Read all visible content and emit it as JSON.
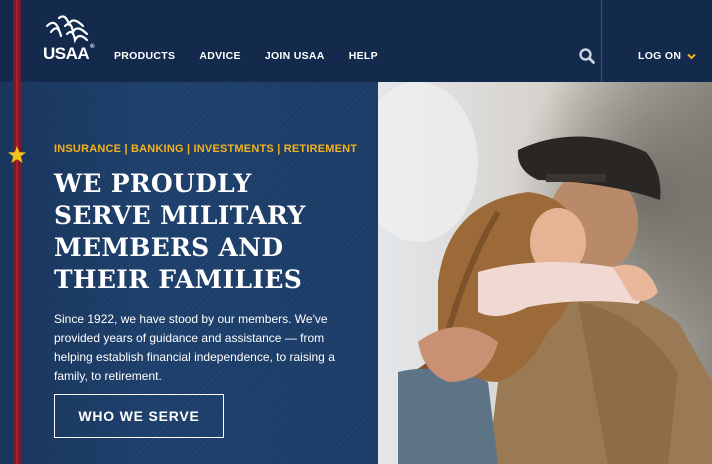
{
  "header": {
    "logo_text": "USAA",
    "logo_reg": "®",
    "nav": [
      "PRODUCTS",
      "ADVICE",
      "JOIN USAA",
      "HELP"
    ],
    "search_icon": "search-icon",
    "logon_label": "LOG ON",
    "logon_icon": "chevron-down-icon"
  },
  "hero": {
    "categories": "INSURANCE | BANKING | INVESTMENTS | RETIREMENT",
    "headline_lines": [
      "WE PROUDLY",
      "SERVE MILITARY",
      "MEMBERS AND",
      "THEIR FAMILIES"
    ],
    "body": "Since 1922, we have stood by our members. We've provided years of guidance and assistance — from helping establish financial independence, to raising a family, to retirement.",
    "cta_label": "WHO WE SERVE",
    "photo_description_icon": "photo-soldier-hugging-girl"
  },
  "colors": {
    "header_bg": "#132a4c",
    "hero_bg": "#1d3f6b",
    "accent_gold": "#f5b21b",
    "stripe_red": "#7e1a28"
  }
}
